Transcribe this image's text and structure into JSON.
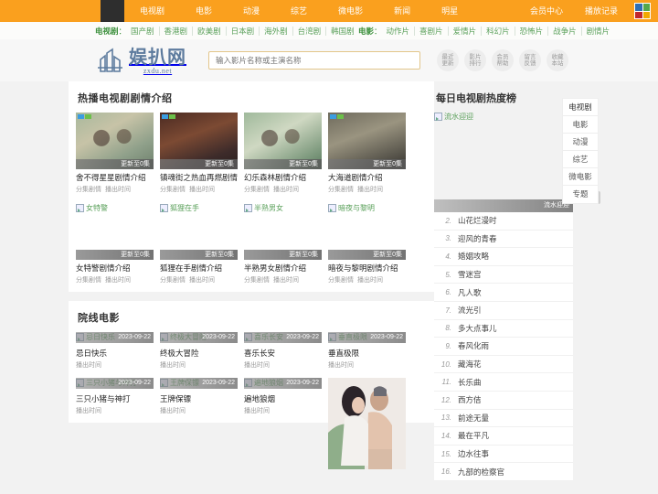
{
  "topnav": {
    "items": [
      {
        "label": "电视剧"
      },
      {
        "label": "电影"
      },
      {
        "label": "动漫"
      },
      {
        "label": "综艺"
      },
      {
        "label": "微电影"
      },
      {
        "label": "新闻"
      },
      {
        "label": "明星"
      }
    ],
    "right": [
      {
        "label": "会员中心"
      },
      {
        "label": "播放记录"
      }
    ],
    "bg_color": "#faa01e",
    "grid_icon_colors": [
      "#2f6fb5",
      "#56a84b",
      "#c0272d",
      "#f2a900"
    ]
  },
  "subnav": {
    "tv": {
      "label": "电视剧",
      "colon": "：",
      "items": [
        "国产剧",
        "香港剧",
        "欧美剧",
        "日本剧",
        "海外剧",
        "台湾剧",
        "韩国剧"
      ]
    },
    "movie": {
      "label": "电影",
      "colon": "：",
      "items": [
        "动作片",
        "喜剧片",
        "爱情片",
        "科幻片",
        "恐怖片",
        "战争片",
        "剧情片"
      ]
    },
    "link_color": "#5aa05a"
  },
  "header": {
    "logo_text": "娱扒网",
    "logo_sub": "zxdu.net",
    "search_placeholder": "输入影片名称或主演名称",
    "search_value": "",
    "quick_links": [
      {
        "line1": "最近",
        "line2": "更新"
      },
      {
        "line1": "影片",
        "line2": "排行"
      },
      {
        "line1": "会员",
        "line2": "帮助"
      },
      {
        "line1": "留言",
        "line2": "反馈"
      },
      {
        "line1": "收藏",
        "line2": "本站"
      }
    ]
  },
  "tv_section": {
    "title": "热播电视剧剧情介绍",
    "row1": [
      {
        "title": "舍不得星星剧情介绍",
        "alt": "舍不得星星",
        "episode": "更新至0集",
        "meta1": "分集剧情",
        "meta2": "播出时间"
      },
      {
        "title": "镇魂街之热血再燃剧情介绍",
        "alt": "镇魂街之热血再燃",
        "episode": "更新至0集",
        "meta1": "分集剧情",
        "meta2": "播出时间"
      },
      {
        "title": "幻乐森林剧情介绍",
        "alt": "幻乐森林",
        "episode": "更新至0集",
        "meta1": "分集剧情",
        "meta2": "播出时间"
      },
      {
        "title": "大海道剧情介绍",
        "alt": "大海道",
        "episode": "更新至0集",
        "meta1": "分集剧情",
        "meta2": "播出时间"
      }
    ],
    "row2": [
      {
        "title": "女特警剧情介绍",
        "alt": "女特警",
        "episode": "更新至0集",
        "meta1": "分集剧情",
        "meta2": "播出时间"
      },
      {
        "title": "狐狸在手剧情介绍",
        "alt": "狐狸在手",
        "episode": "更新至0集",
        "meta1": "分集剧情",
        "meta2": "播出时间"
      },
      {
        "title": "半熟男女剧情介绍",
        "alt": "半熟男女",
        "episode": "更新至0集",
        "meta1": "分集剧情",
        "meta2": "播出时间"
      },
      {
        "title": "暗夜与黎明剧情介绍",
        "alt": "暗夜与黎明",
        "episode": "更新至0集",
        "meta1": "分集剧情",
        "meta2": "播出时间"
      }
    ]
  },
  "movie_section": {
    "title": "院线电影",
    "row1": [
      {
        "title": "忌日快乐",
        "alt": "忌日快乐",
        "date": "2023-09-22",
        "meta": "播出时间"
      },
      {
        "title": "终极大冒险",
        "alt": "终极大冒险",
        "date": "2023-09-22",
        "meta": "播出时间"
      },
      {
        "title": "喜乐长安",
        "alt": "喜乐长安",
        "date": "2023-09-22",
        "meta": "播出时间"
      },
      {
        "title": "垂直极限",
        "alt": "垂直极限",
        "date": "2023-09-22",
        "meta": "播出时间"
      }
    ],
    "row2": [
      {
        "title": "三只小猪与神打",
        "alt": "三只小猪与神打",
        "date": "2023-09-22",
        "meta": "播出时间"
      },
      {
        "title": "王牌保镖",
        "alt": "王牌保镖",
        "date": "2023-09-22",
        "meta": "播出时间"
      },
      {
        "title": "遍地狼烟",
        "alt": "遍地狼烟",
        "date": "2023-09-22",
        "meta": "播出时间"
      },
      {
        "title": "",
        "alt": "",
        "date": "",
        "meta": ""
      }
    ]
  },
  "ranking": {
    "title": "每日电视剧热度榜",
    "tabs": [
      {
        "label": "电视剧",
        "active": true
      },
      {
        "label": "电影",
        "active": false
      },
      {
        "label": "动漫",
        "active": false
      },
      {
        "label": "综艺",
        "active": false
      },
      {
        "label": "微电影",
        "active": false
      },
      {
        "label": "专题",
        "active": false
      }
    ],
    "hero": {
      "alt": "流水迎迎",
      "caption": "流水迎迎"
    },
    "items": [
      {
        "num": "2.",
        "name": "山花烂漫时"
      },
      {
        "num": "3.",
        "name": "迎风的青春"
      },
      {
        "num": "4.",
        "name": "婚姻攻略"
      },
      {
        "num": "5.",
        "name": "雪迷宫"
      },
      {
        "num": "6.",
        "name": "凡人歌"
      },
      {
        "num": "7.",
        "name": "流光引"
      },
      {
        "num": "8.",
        "name": "多大点事儿"
      },
      {
        "num": "9.",
        "name": "春风化雨"
      },
      {
        "num": "10.",
        "name": "藏海花"
      },
      {
        "num": "11.",
        "name": "长乐曲"
      },
      {
        "num": "12.",
        "name": "西方佶"
      },
      {
        "num": "13.",
        "name": "前途无量"
      },
      {
        "num": "14.",
        "name": "最在平凡"
      },
      {
        "num": "15.",
        "name": "边水往事"
      },
      {
        "num": "16.",
        "name": "九部的检察官"
      }
    ]
  }
}
